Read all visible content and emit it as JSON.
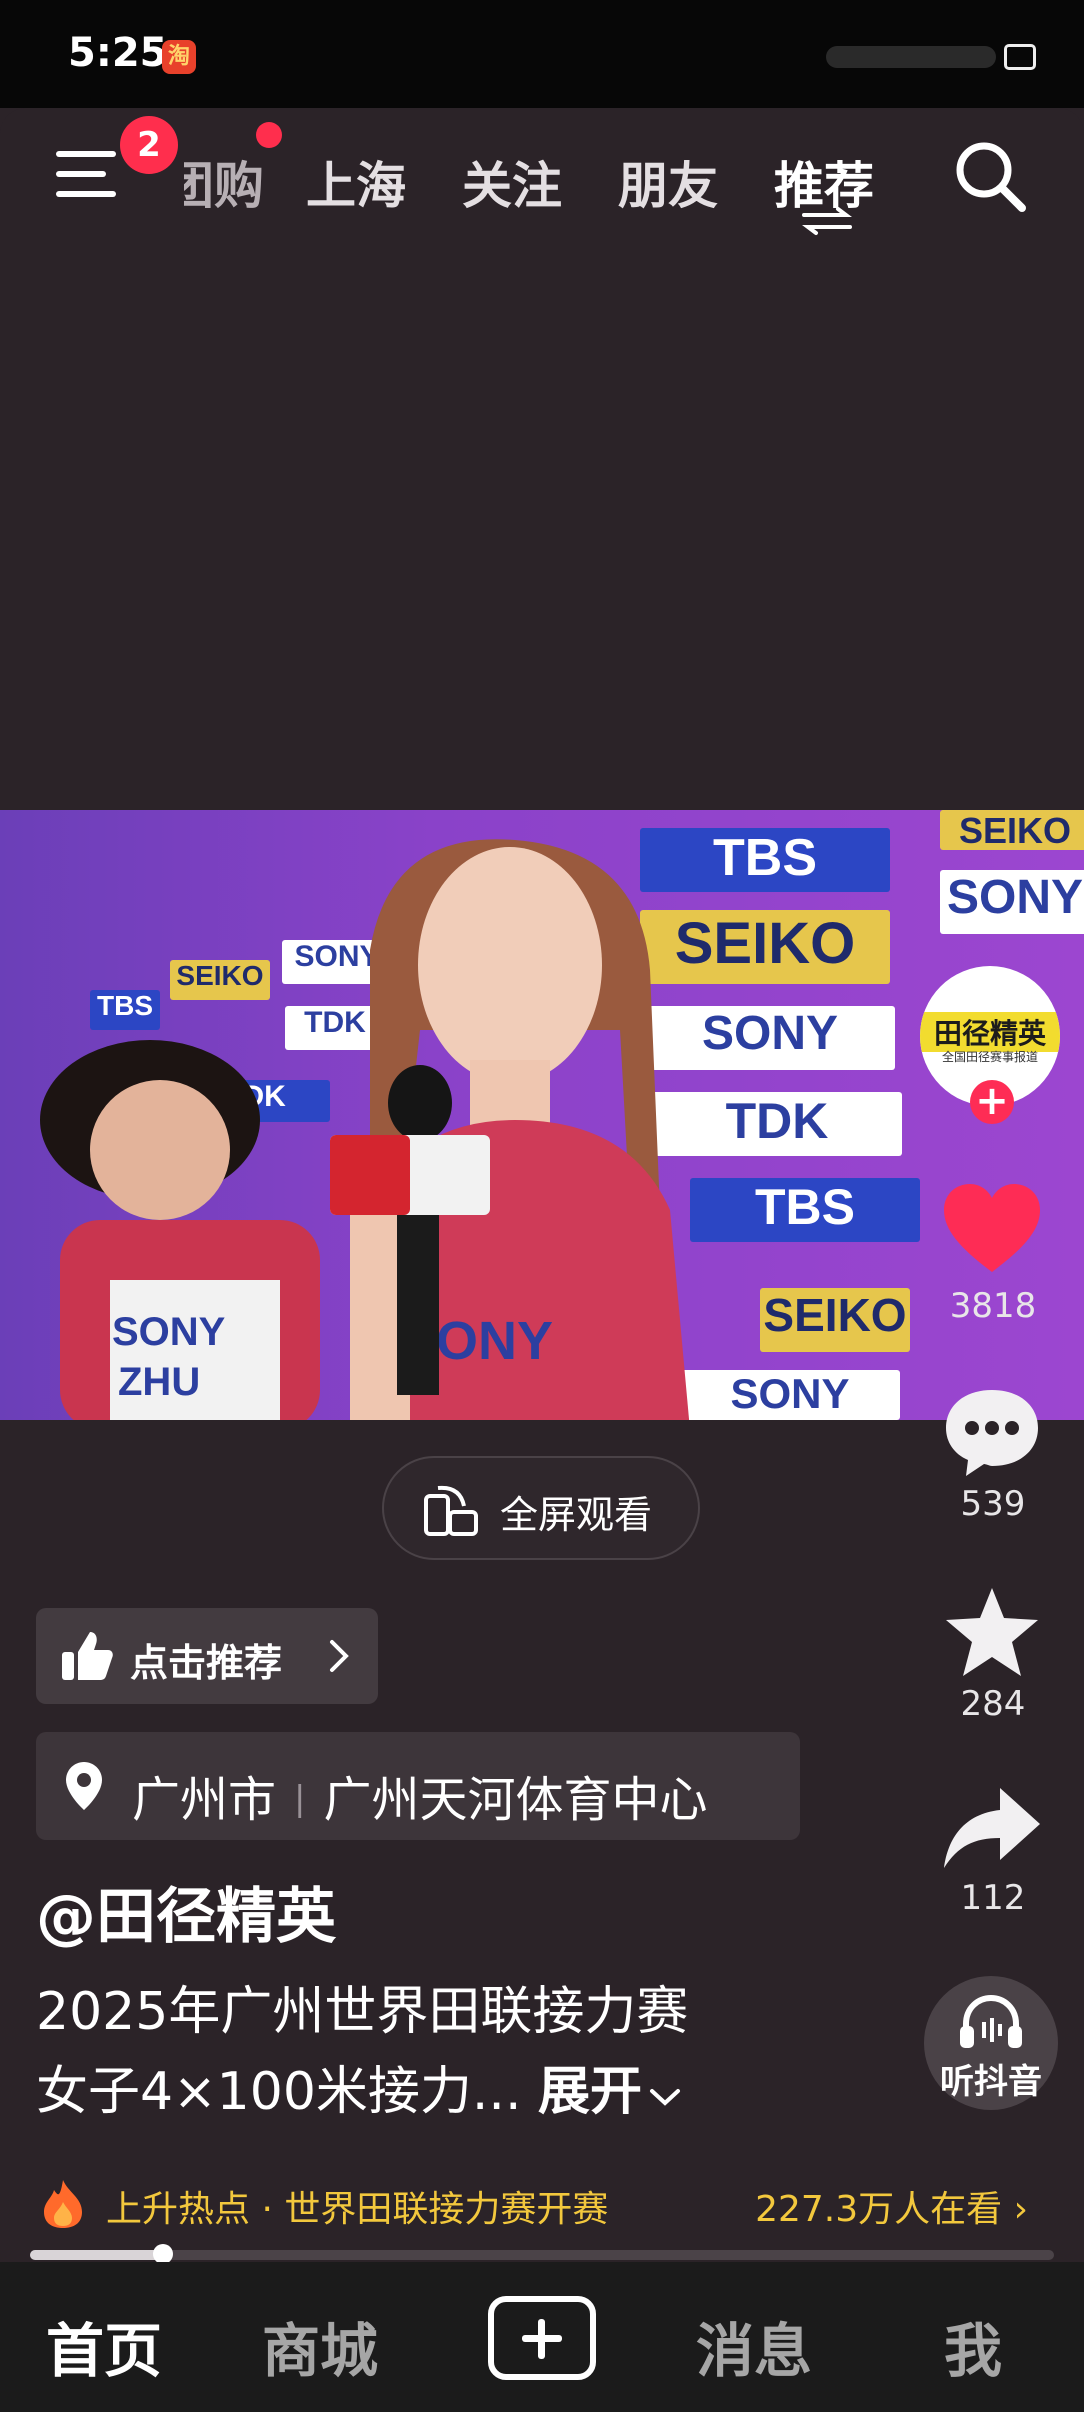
{
  "status_bar": {
    "time": "5:25",
    "app_icon_glyph": "淘"
  },
  "top_nav": {
    "menu_badge": "2",
    "tabs": [
      {
        "label": "团购"
      },
      {
        "label": "上海"
      },
      {
        "label": "关注"
      },
      {
        "label": "朋友"
      },
      {
        "label": "推荐"
      }
    ],
    "active_tab": "推荐"
  },
  "video": {
    "sponsor_boards": [
      "TBS",
      "SEIKO",
      "SONY",
      "TDK",
      "SEIKO",
      "TBS",
      "SONY",
      "TDK",
      "TBS",
      "SEIKO",
      "SONY",
      "SONY",
      "SEIKO",
      "TDK"
    ],
    "bib_left": "SONY",
    "bib_left_name": "ZHU",
    "bib_right": "SONY"
  },
  "side_actions": {
    "avatar_name": "田径精英",
    "avatar_sub": "全国田径赛事报道",
    "likes": "3818",
    "comments": "539",
    "favorites": "284",
    "shares": "112",
    "listen_label": "听抖音"
  },
  "fullscreen": {
    "label": "全屏观看"
  },
  "recommend": {
    "label": "点击推荐"
  },
  "location": {
    "city": "广州市",
    "venue": "广州天河体育中心"
  },
  "author": "@田径精英",
  "description": {
    "line1": "2025年广州世界田联接力赛",
    "line2": "女子4×100米接力...",
    "expand": "展开"
  },
  "hot": {
    "text": "上升热点 · 世界田联接力赛开赛",
    "watchers": "227.3万人在看"
  },
  "progress": {
    "fraction": 0.13
  },
  "bottom_nav": {
    "home": "首页",
    "mall": "商城",
    "messages": "消息",
    "me": "我"
  },
  "colors": {
    "background": "#2b2328",
    "accent_red": "#fe2c55",
    "hot_yellow": "#f3c83d"
  }
}
